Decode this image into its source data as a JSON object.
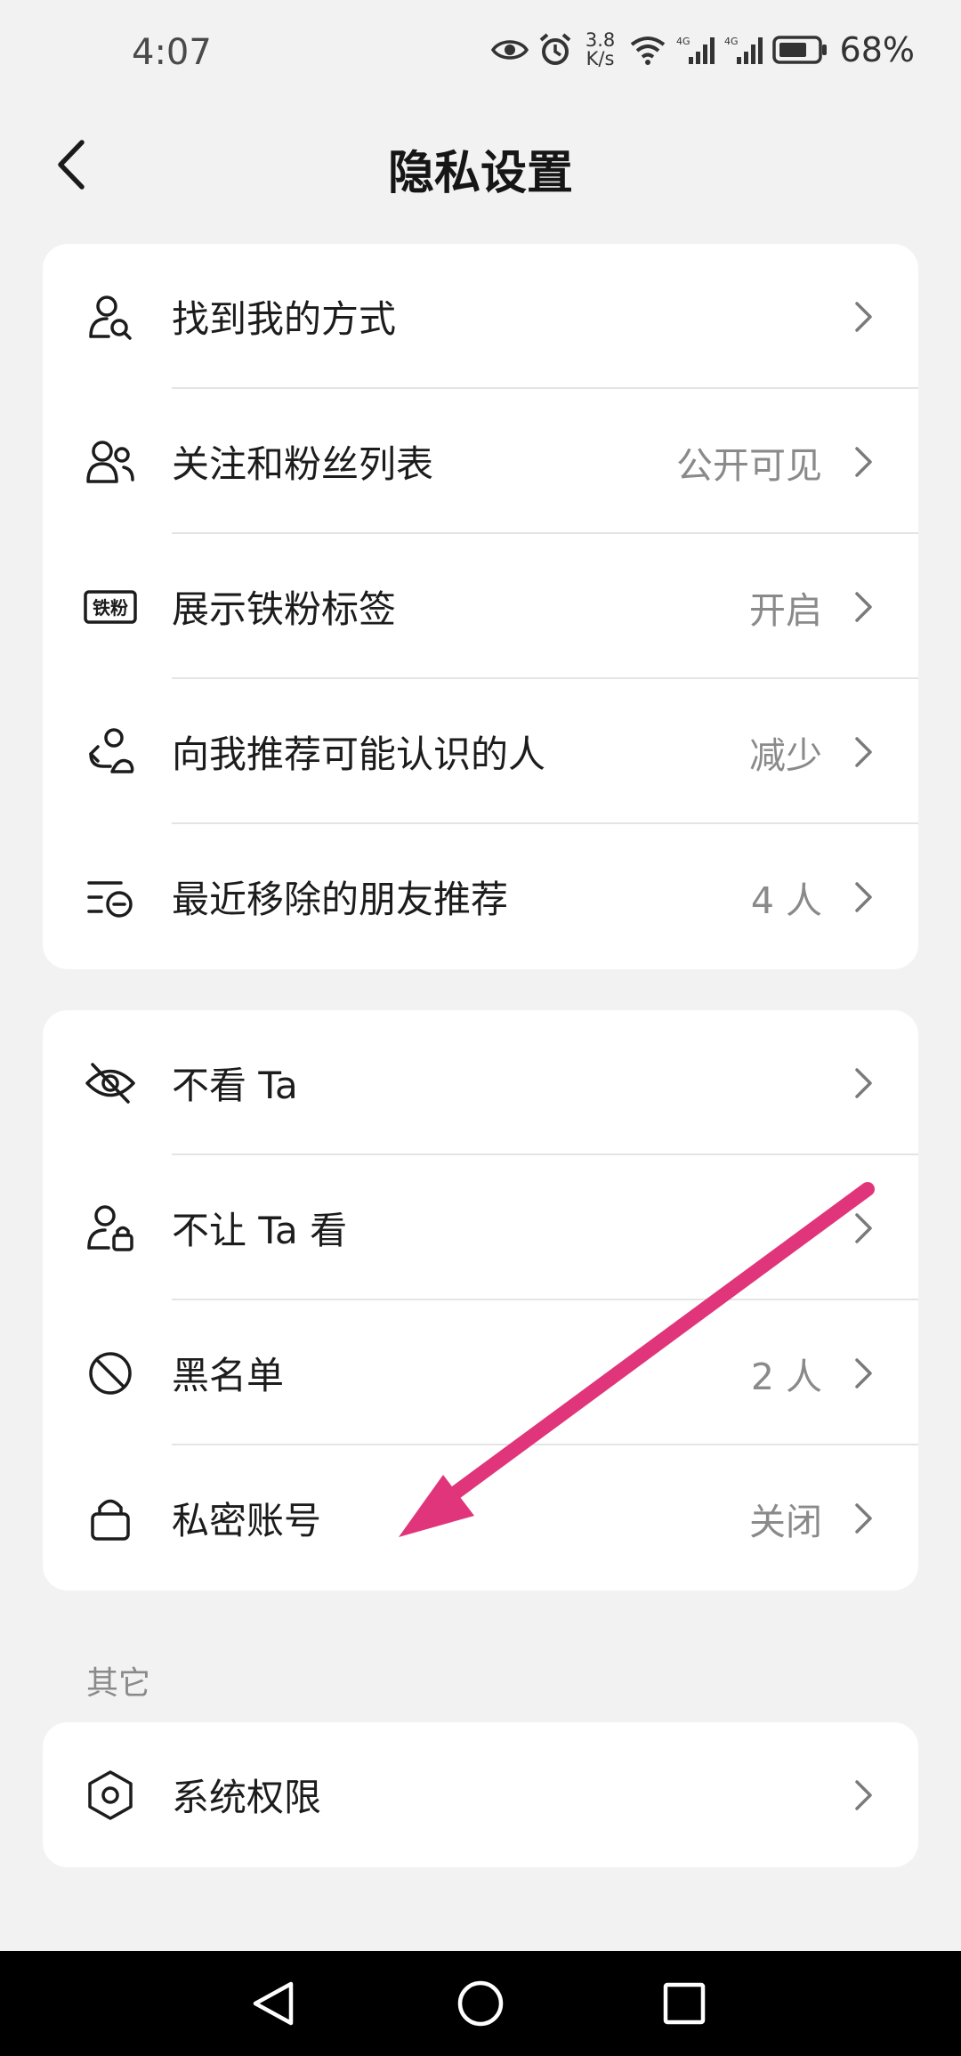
{
  "status_bar": {
    "time": "4:07",
    "net_speed_value": "3.8",
    "net_speed_unit": "K/s",
    "battery": "68%"
  },
  "header": {
    "title": "隐私设置"
  },
  "group1": [
    {
      "label": "找到我的方式",
      "value": "",
      "icon": "person-search-icon"
    },
    {
      "label": "关注和粉丝列表",
      "value": "公开可见",
      "icon": "people-icon"
    },
    {
      "label": "展示铁粉标签",
      "value": "开启",
      "icon": "iron-fan-badge-icon",
      "badge_text": "铁粉"
    },
    {
      "label": "向我推荐可能认识的人",
      "value": "减少",
      "icon": "person-recommend-icon"
    },
    {
      "label": "最近移除的朋友推荐",
      "value": "4 人",
      "icon": "list-remove-icon"
    }
  ],
  "group2": [
    {
      "label": "不看 Ta",
      "value": "",
      "icon": "eye-off-icon"
    },
    {
      "label": "不让 Ta 看",
      "value": "",
      "icon": "person-lock-icon"
    },
    {
      "label": "黑名单",
      "value": "2 人",
      "icon": "block-icon"
    },
    {
      "label": "私密账号",
      "value": "关闭",
      "icon": "lock-icon"
    }
  ],
  "other_section": {
    "label": "其它",
    "items": [
      {
        "label": "系统权限",
        "value": "",
        "icon": "hexagon-settings-icon"
      }
    ]
  },
  "annotation": {
    "arrow_color": "#e0357a"
  }
}
